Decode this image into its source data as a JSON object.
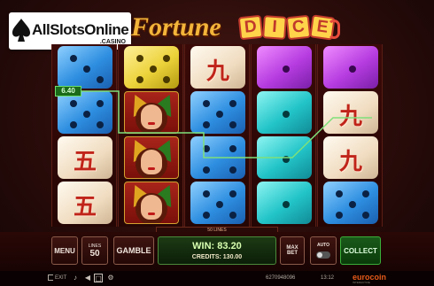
{
  "logo": {
    "text": "AllSlotsOnline",
    "subtext": ".CASINO"
  },
  "game_title": {
    "word": "Fortune",
    "dice_letters": [
      "D",
      "I",
      "C",
      "E"
    ]
  },
  "reels": [
    [
      {
        "type": "die",
        "color": "blue",
        "value": 3
      },
      {
        "type": "die",
        "color": "blue",
        "value": 5
      },
      {
        "type": "symbol",
        "glyph": "五"
      },
      {
        "type": "symbol",
        "glyph": "五"
      }
    ],
    [
      {
        "type": "die",
        "color": "yellow",
        "value": 5
      },
      {
        "type": "jester"
      },
      {
        "type": "jester"
      },
      {
        "type": "jester"
      }
    ],
    [
      {
        "type": "symbol",
        "glyph": "九"
      },
      {
        "type": "die",
        "color": "blue",
        "value": 5
      },
      {
        "type": "die",
        "color": "blue",
        "value": 4
      },
      {
        "type": "die",
        "color": "blue",
        "value": 5
      }
    ],
    [
      {
        "type": "die",
        "color": "purple",
        "value": 1
      },
      {
        "type": "die",
        "color": "cyan",
        "value": 1
      },
      {
        "type": "die",
        "color": "cyan",
        "value": 1
      },
      {
        "type": "die",
        "color": "cyan",
        "value": 1
      }
    ],
    [
      {
        "type": "die",
        "color": "purple",
        "value": 1
      },
      {
        "type": "symbol",
        "glyph": "九"
      },
      {
        "type": "symbol",
        "glyph": "九"
      },
      {
        "type": "die",
        "color": "blue",
        "value": 5
      }
    ]
  ],
  "win_line": {
    "amount": "6.40",
    "color": "#7fe07a"
  },
  "lines_bar": "50 LINES",
  "controls": {
    "menu": "MENU",
    "lines_caption": "LINES",
    "lines_value": "50",
    "gamble": "GAMBLE",
    "win_label": "WIN: 83.20",
    "credits_label": "CREDITS: 130.00",
    "max_bet": "MAX BET",
    "auto": "AUTO",
    "collect": "COLLECT"
  },
  "footer": {
    "exit": "EXIT",
    "game_id": "6270948096",
    "time": "13:12",
    "brand": "eurocoin",
    "brand_sub": "INTERACTIVE",
    "icons": [
      "sound-icon",
      "speaker-icon",
      "fullscreen-icon",
      "settings-icon"
    ]
  },
  "colors": {
    "background": "#2a0c0a",
    "accent_gold": "#f3b53a",
    "dice_red": "#c0392b",
    "win_green": "#7fe07a",
    "collect_green": "#3ab03a"
  }
}
